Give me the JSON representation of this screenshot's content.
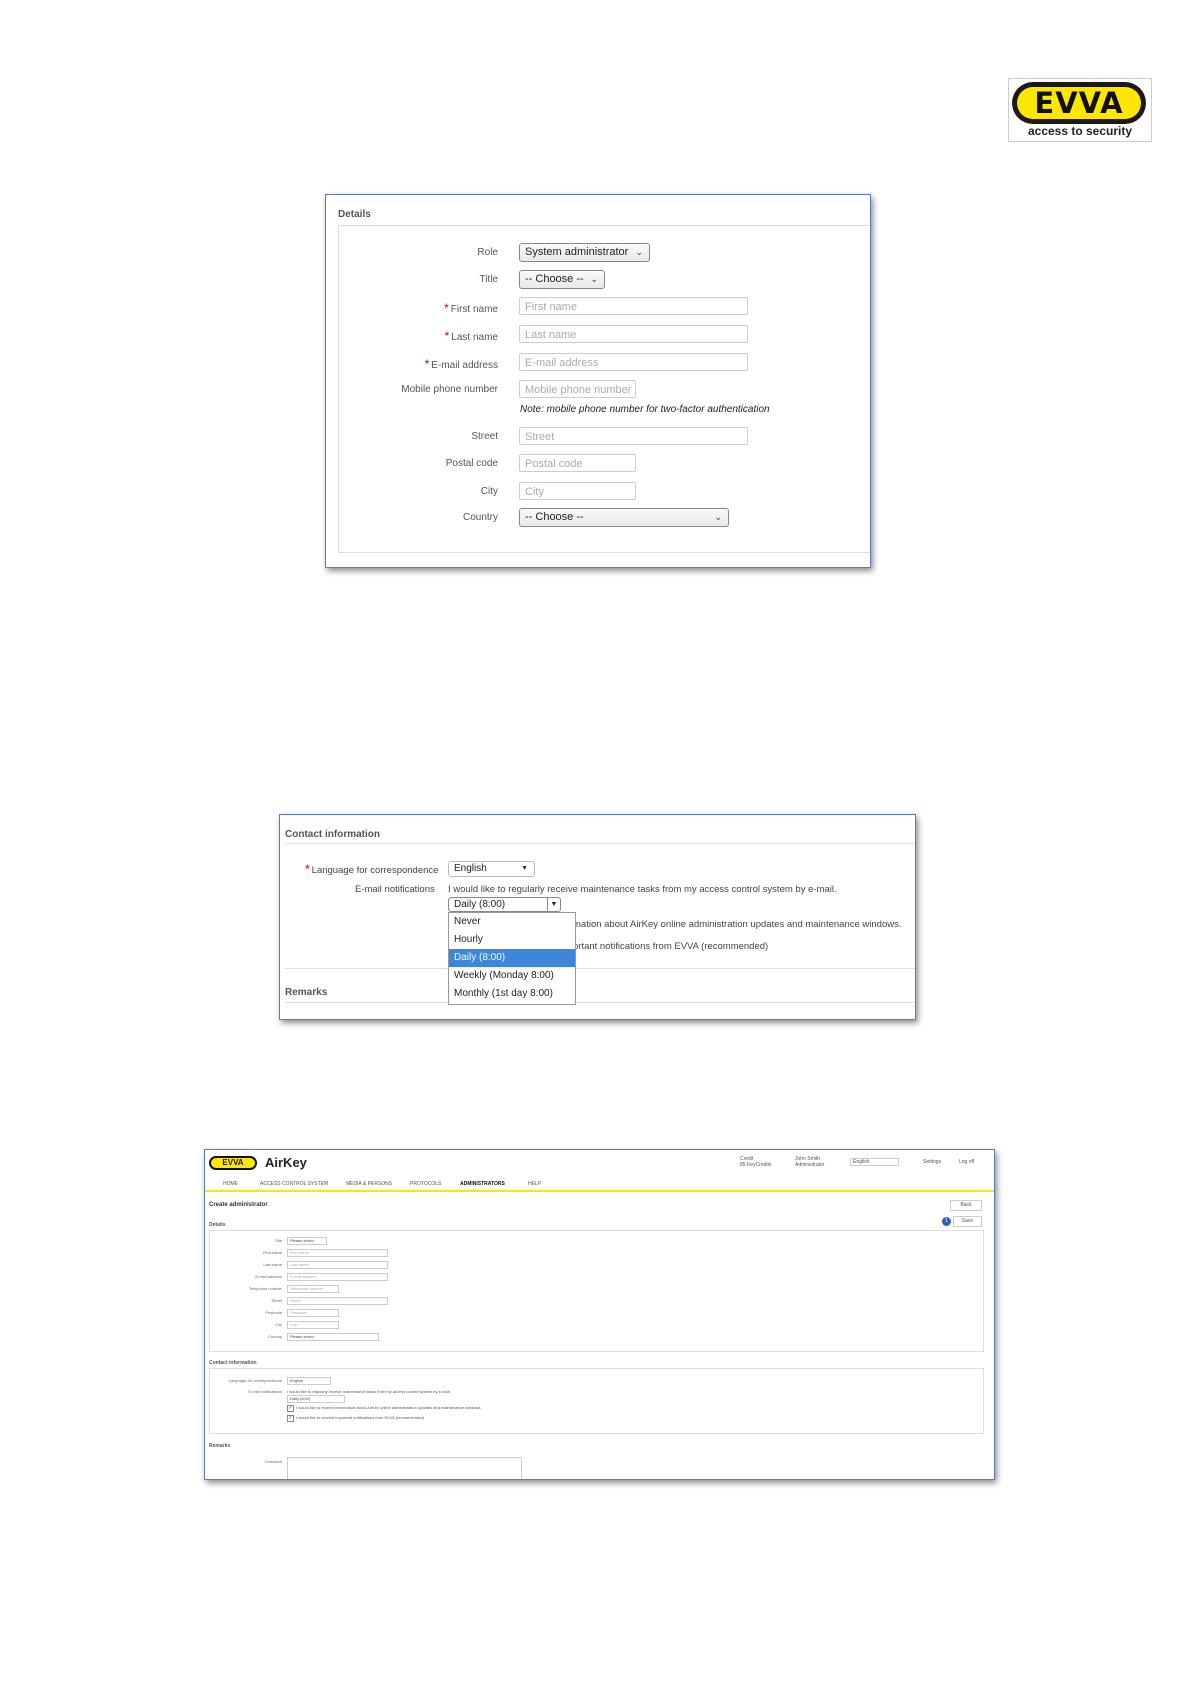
{
  "logo": {
    "wordmark": "EVVA",
    "tagline": "access to security"
  },
  "details_panel": {
    "title": "Details",
    "role_label": "Role",
    "role_value": "System administrator",
    "title_label": "Title",
    "title_value": "-- Choose --",
    "first_name_label": "First name",
    "first_name_placeholder": "First name",
    "last_name_label": "Last name",
    "last_name_placeholder": "Last name",
    "email_label": "E-mail address",
    "email_placeholder": "E-mail address",
    "mobile_label": "Mobile phone number",
    "mobile_placeholder": "Mobile phone number",
    "mobile_note": "Note: mobile phone number for two-factor authentication",
    "street_label": "Street",
    "street_placeholder": "Street",
    "postal_label": "Postal code",
    "postal_placeholder": "Postal code",
    "city_label": "City",
    "city_placeholder": "City",
    "country_label": "Country",
    "country_value": "-- Choose --"
  },
  "contact_panel": {
    "title": "Contact information",
    "language_label": "Language for correspondence",
    "language_value": "English",
    "email_notif_label": "E-mail notifications",
    "maintenance_text": "I would like to regularly receive maintenance tasks from my access control system by e-mail.",
    "frequency_value": "Daily (8:00)",
    "partial_text_1": "mation about AirKey online administration updates and maintenance windows.",
    "partial_text_2": "ortant notifications from EVVA (recommended)",
    "frequency_options": [
      "Never",
      "Hourly",
      "Daily (8:00)",
      "Weekly (Monday 8:00)",
      "Monthly (1st day 8:00)"
    ],
    "remarks_title": "Remarks"
  },
  "app_panel": {
    "brand": "EVVA",
    "app_name": "AirKey",
    "header_items": {
      "credit": "Credit",
      "credit_sub": "85 KeyCredits",
      "user": "John Smith",
      "user_sub": "Administrator",
      "language": "English",
      "settings": "Settings",
      "logoff": "Log off"
    },
    "nav": [
      "HOME",
      "ACCESS CONTROL SYSTEM",
      "MEDIA & PERSONS",
      "PROTOCOLS",
      "ADMINISTRATORS",
      "HELP"
    ],
    "page_title": "Create administrator",
    "back_label": "Back",
    "save_label": "Save",
    "step_badge": "1",
    "details_title": "Details",
    "form": [
      {
        "label": "Title",
        "value": "Please select",
        "type": "select"
      },
      {
        "label": "First name",
        "value": "First name",
        "type": "input",
        "req": true
      },
      {
        "label": "Last name",
        "value": "Last name",
        "type": "input",
        "req": true
      },
      {
        "label": "E-mail address",
        "value": "E-mail address",
        "type": "input",
        "req": true
      },
      {
        "label": "Telephone number",
        "value": "Telephone number",
        "type": "input"
      },
      {
        "label": "Street",
        "value": "Street",
        "type": "input"
      },
      {
        "label": "Postcode",
        "value": "Postcode",
        "type": "input"
      },
      {
        "label": "City",
        "value": "City",
        "type": "input"
      },
      {
        "label": "Country",
        "value": "Please select",
        "type": "select"
      }
    ],
    "contact_title": "Contact information",
    "language_label": "Language for correspondence",
    "language_value": "English",
    "email_notif_label": "E-mail notifications",
    "maintenance_text": "I would like to regularly receive maintenance tasks from my access control system by e-mail.",
    "frequency_value": "Daily (8:00)",
    "check1": "I would like to receive information about AirKey online administration updates and maintenance windows.",
    "check2": "I would like to receive important notifications from EVVA (recommended)",
    "remarks_title": "Remarks",
    "comment_label": "Comment"
  }
}
